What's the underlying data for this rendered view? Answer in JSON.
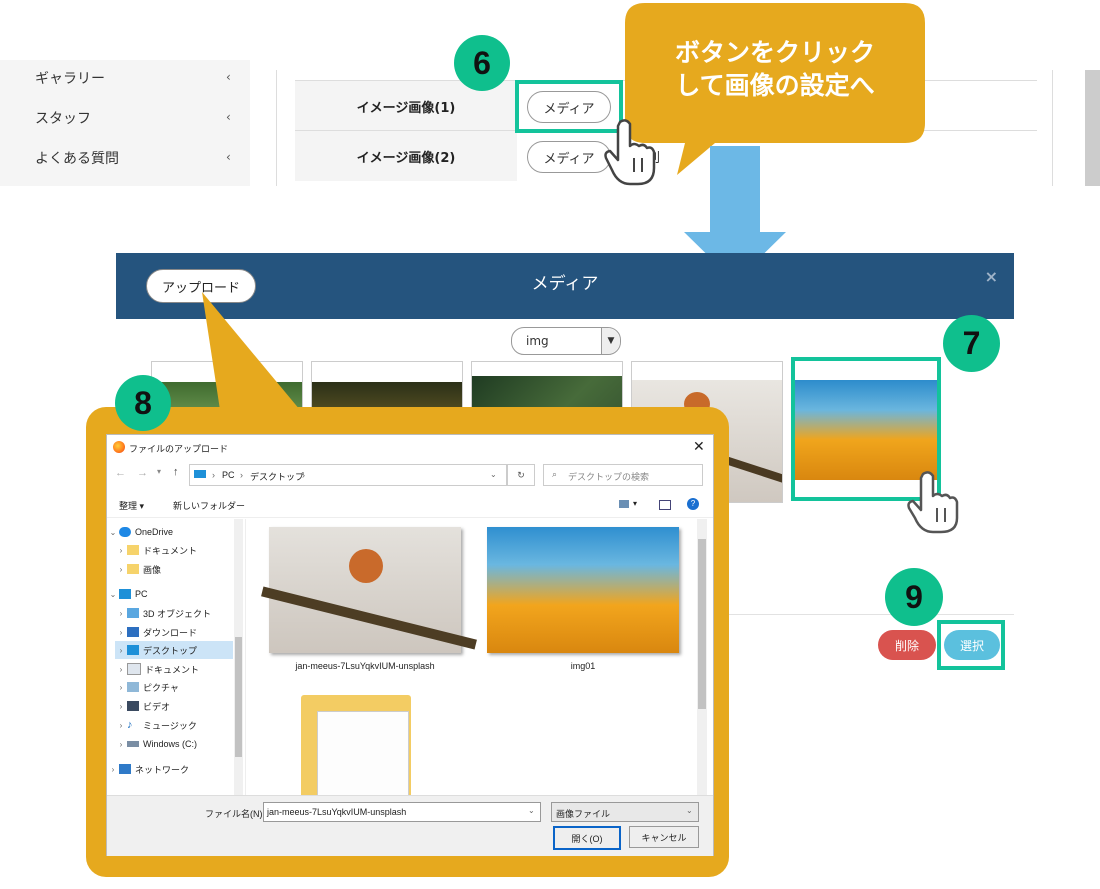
{
  "sidebar": {
    "items": [
      {
        "label": "ギャラリー"
      },
      {
        "label": "スタッフ"
      },
      {
        "label": "よくある質問"
      }
    ]
  },
  "form": {
    "rows": [
      {
        "label": "イメージ画像(1)",
        "button": "メディア"
      },
      {
        "label": "イメージ画像(2)",
        "button": "メディア",
        "suffix": "削"
      }
    ]
  },
  "callout": {
    "line1": "ボタンをクリック",
    "line2": "して画像の設定へ"
  },
  "badges": {
    "step6": "6",
    "step7": "7",
    "step8": "8",
    "step9": "9"
  },
  "modal": {
    "title": "メディア",
    "upload_label": "アップロード",
    "close_glyph": "×",
    "filter": {
      "selected": "img"
    },
    "delete_label": "削除",
    "select_label": "選択"
  },
  "file_dialog": {
    "title": "ファイルのアップロード",
    "breadcrumb": [
      "PC",
      "デスクトップ"
    ],
    "search_placeholder": "デスクトップの検索",
    "toolbar": {
      "organize": "整理 ▾",
      "new_folder": "新しいフォルダー"
    },
    "tree": [
      {
        "label": "OneDrive",
        "icon": "cloud-icon",
        "arrow": "down"
      },
      {
        "label": "ドキュメント",
        "icon": "folder-icon",
        "arrow": "right"
      },
      {
        "label": "画像",
        "icon": "folder-icon",
        "arrow": "right"
      },
      {
        "label": "PC",
        "icon": "computer-icon",
        "arrow": "down"
      },
      {
        "label": "3D オブジェクト",
        "icon": "cube-icon",
        "arrow": "right"
      },
      {
        "label": "ダウンロード",
        "icon": "download-icon",
        "arrow": "right"
      },
      {
        "label": "デスクトップ",
        "icon": "desktop-icon",
        "arrow": "right",
        "selected": true
      },
      {
        "label": "ドキュメント",
        "icon": "document-icon",
        "arrow": "right"
      },
      {
        "label": "ピクチャ",
        "icon": "picture-icon",
        "arrow": "right"
      },
      {
        "label": "ビデオ",
        "icon": "video-icon",
        "arrow": "right"
      },
      {
        "label": "ミュージック",
        "icon": "music-icon",
        "arrow": "right"
      },
      {
        "label": "Windows (C:)",
        "icon": "drive-icon",
        "arrow": "right"
      },
      {
        "label": "ネットワーク",
        "icon": "network-icon",
        "arrow": "right"
      }
    ],
    "files": [
      {
        "name": "jan-meeus-7LsuYqkvIUM-unsplash"
      },
      {
        "name": "img01"
      }
    ],
    "filename_label": "ファイル名(N):",
    "filename_value": "jan-meeus-7LsuYqkvIUM-unsplash",
    "filetype_value": "画像ファイル",
    "open_label": "開く(O)",
    "cancel_label": "キャンセル"
  },
  "colors": {
    "accent_green": "#13c39b",
    "callout_gold": "#e6a91e",
    "modal_header": "#25547e",
    "arrow_blue": "#6cb8e6",
    "delete_red": "#d9534f",
    "select_blue": "#5bc0de"
  }
}
